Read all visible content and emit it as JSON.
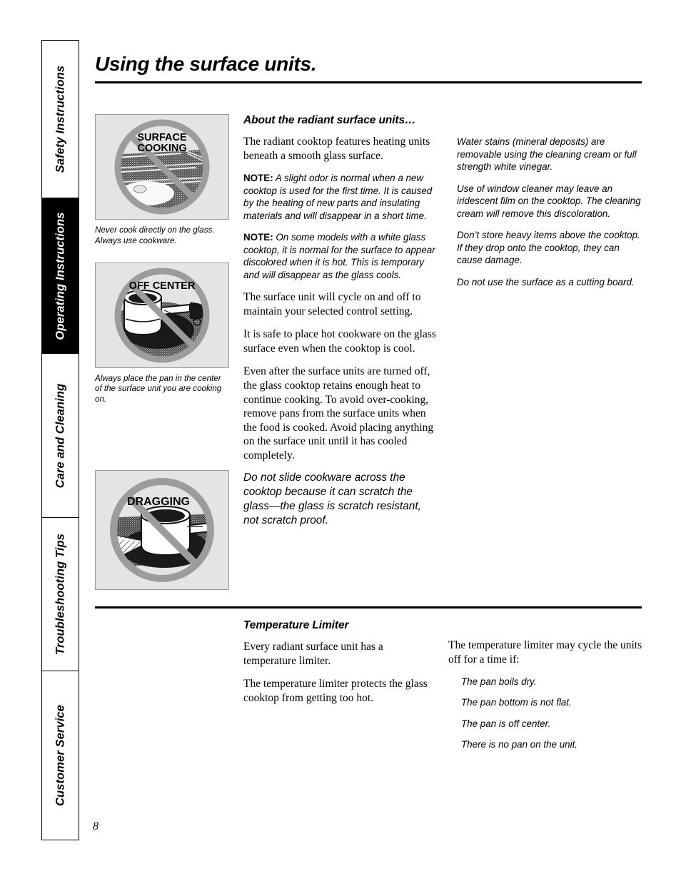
{
  "page": {
    "title": "Using the surface units.",
    "number": "8"
  },
  "sidebar": {
    "tabs": [
      {
        "label": "Safety Instructions",
        "active": false
      },
      {
        "label": "Operating Instructions",
        "active": true
      },
      {
        "label": "Care and Cleaning",
        "active": false
      },
      {
        "label": "Troubleshooting Tips",
        "active": false
      },
      {
        "label": "Customer Service",
        "active": false
      }
    ]
  },
  "figures": [
    {
      "overlay_label": "SURFACE COOKING",
      "icon": "no-surface-cooking-icon",
      "caption": "Never cook directly on the glass. Always use cookware."
    },
    {
      "overlay_label": "OFF CENTER",
      "icon": "no-off-center-pan-icon",
      "caption": "Always place the pan in the center of the surface unit you are cooking on."
    },
    {
      "overlay_label": "DRAGGING",
      "icon": "no-dragging-pan-icon",
      "caption": ""
    }
  ],
  "section_about": {
    "heading": "About the radiant surface units…",
    "paragraphs": [
      "The radiant cooktop features heating units beneath a smooth glass surface.",
      "The surface unit will cycle on and off to maintain your selected control setting.",
      "It is safe to place hot cookware on the glass surface even when the cooktop is cool.",
      "Even after the surface units are turned off, the glass cooktop retains enough heat to continue cooking. To avoid over-cooking, remove pans from the surface units when the food is cooked. Avoid placing anything on the surface unit until it has cooled completely."
    ],
    "note_label": "NOTE:",
    "note1": "A slight odor is normal when a new cooktop is used for the first time. It is caused by the heating of new parts and insulating materials and will disappear in a short time.",
    "note2": "On some models with a white glass cooktop, it is normal for the surface to appear discolored when it is hot. This is temporary and will disappear as the glass cools.",
    "dragging_text": "Do not slide cookware across the cooktop because it can scratch the glass—the glass is scratch resistant, not scratch proof."
  },
  "section_right": {
    "paragraphs": [
      "Water stains (mineral deposits) are removable using the cleaning cream or full strength white vinegar.",
      "Use of window cleaner may leave an iridescent film on the cooktop. The cleaning cream will remove this discoloration.",
      "Don’t store heavy items above the cooktop. If they drop onto the cooktop, they can cause damage.",
      "Do not use the surface as a cutting board."
    ]
  },
  "section_limiter": {
    "heading": "Temperature Limiter",
    "paragraphs": [
      "Every radiant surface unit has a temperature limiter.",
      "The temperature limiter protects the glass cooktop from getting too hot."
    ],
    "intro": "The temperature limiter may cycle the units off for a time if:",
    "items": [
      "The pan boils dry.",
      "The pan bottom is not flat.",
      "The pan is off center.",
      "There is no pan on the unit."
    ]
  },
  "colors": {
    "figure_background": "#e4e4e4",
    "prohibition_ring": "#9c9c9c",
    "active_tab": "#000000"
  }
}
